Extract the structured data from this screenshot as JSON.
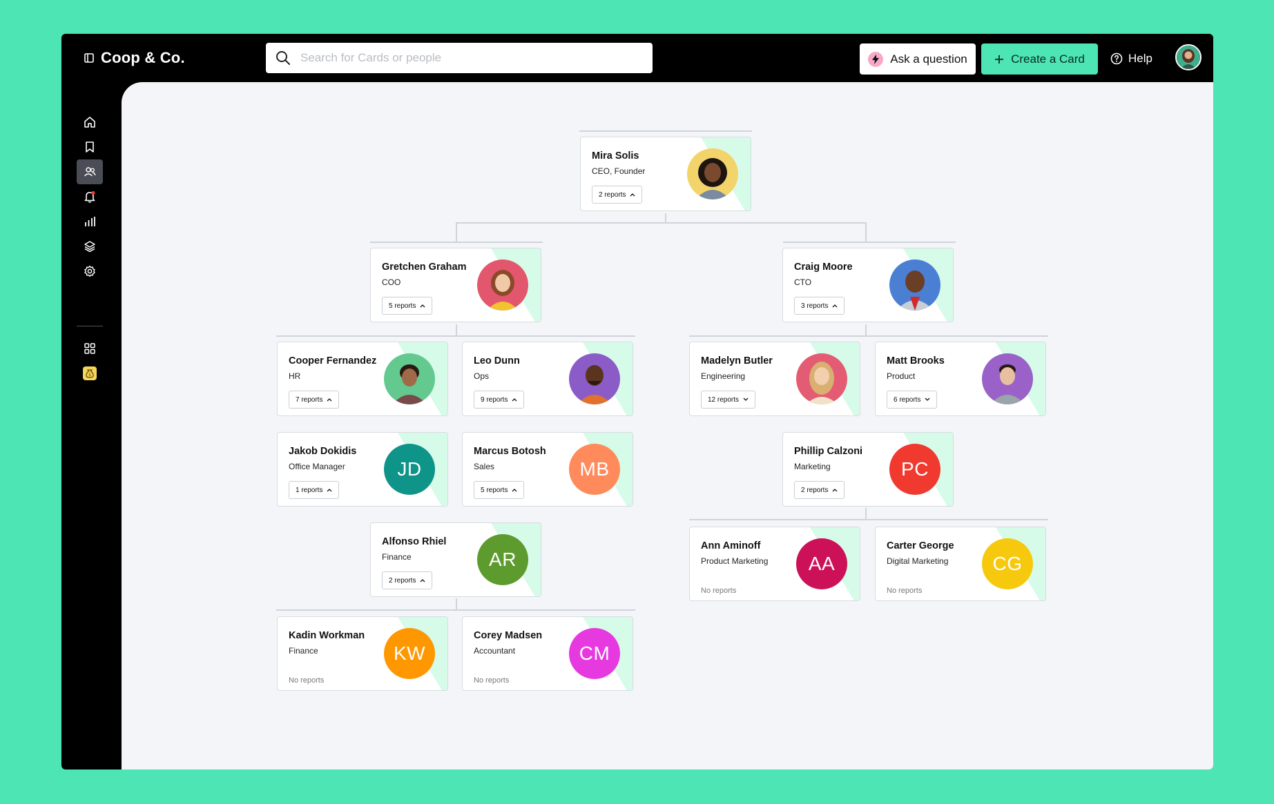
{
  "app": {
    "brand": "Coop & Co."
  },
  "search": {
    "placeholder": "Search for Cards or people"
  },
  "header": {
    "ask_label": "Ask a question",
    "create_label": "Create a Card",
    "help_label": "Help"
  },
  "colors": {
    "accent": "#4de5b4",
    "sidebar_bg": "#000000",
    "content_bg": "#f4f5f8",
    "card_stripe": "#d6fbe9"
  },
  "sidebar": {
    "items": [
      {
        "icon": "home-icon"
      },
      {
        "icon": "bookmark-icon"
      },
      {
        "icon": "people-icon",
        "active": true
      },
      {
        "icon": "bell-icon"
      },
      {
        "icon": "chart-icon"
      },
      {
        "icon": "layers-icon"
      },
      {
        "icon": "gear-icon"
      },
      {
        "icon": "grid-icon"
      },
      {
        "icon": "money-bag-icon"
      }
    ]
  },
  "people": {
    "mira": {
      "name": "Mira Solis",
      "role": "CEO, Founder",
      "reports": "2 reports",
      "chevron": "up",
      "avatar_color": "#f2d46a"
    },
    "gretchen": {
      "name": "Gretchen Graham",
      "role": "COO",
      "reports": "5 reports",
      "chevron": "up",
      "avatar_color": "#e2566e"
    },
    "craig": {
      "name": "Craig Moore",
      "role": "CTO",
      "reports": "3 reports",
      "chevron": "up",
      "avatar_color": "#4a7fd4"
    },
    "cooper": {
      "name": "Cooper Fernandez",
      "role": "HR",
      "reports": "7 reports",
      "chevron": "up",
      "avatar_color": "#63c98f"
    },
    "leo": {
      "name": "Leo Dunn",
      "role": "Ops",
      "reports": "9 reports",
      "chevron": "up",
      "avatar_color": "#8b5cc7"
    },
    "madelyn": {
      "name": "Madelyn Butler",
      "role": "Engineering",
      "reports": "12 reports",
      "chevron": "down",
      "avatar_color": "#e45c73"
    },
    "matt": {
      "name": "Matt Brooks",
      "role": "Product",
      "reports": "6 reports",
      "chevron": "down",
      "avatar_color": "#9a62c9"
    },
    "jakob": {
      "name": "Jakob Dokidis",
      "role": "Office Manager",
      "reports": "1 reports",
      "chevron": "up",
      "initials": "JD",
      "avatar_color": "#0e9488"
    },
    "marcus": {
      "name": "Marcus Botosh",
      "role": "Sales",
      "reports": "5 reports",
      "chevron": "up",
      "initials": "MB",
      "avatar_color": "#ff8a5c"
    },
    "phillip": {
      "name": "Phillip Calzoni",
      "role": "Marketing",
      "reports": "2 reports",
      "chevron": "up",
      "initials": "PC",
      "avatar_color": "#f0392f"
    },
    "alfonso": {
      "name": "Alfonso Rhiel",
      "role": "Finance",
      "reports": "2 reports",
      "chevron": "up",
      "initials": "AR",
      "avatar_color": "#5e9b2e"
    },
    "ann": {
      "name": "Ann Aminoff",
      "role": "Product Marketing",
      "reports": "No reports",
      "initials": "AA",
      "avatar_color": "#cc1158"
    },
    "carter": {
      "name": "Carter George",
      "role": "Digital Marketing",
      "reports": "No reports",
      "initials": "CG",
      "avatar_color": "#f6c90e"
    },
    "kadin": {
      "name": "Kadin Workman",
      "role": "Finance",
      "reports": "No reports",
      "initials": "KW",
      "avatar_color": "#ff9800"
    },
    "corey": {
      "name": "Corey Madsen",
      "role": "Accountant",
      "reports": "No reports",
      "initials": "CM",
      "avatar_color": "#e63ae0"
    }
  }
}
